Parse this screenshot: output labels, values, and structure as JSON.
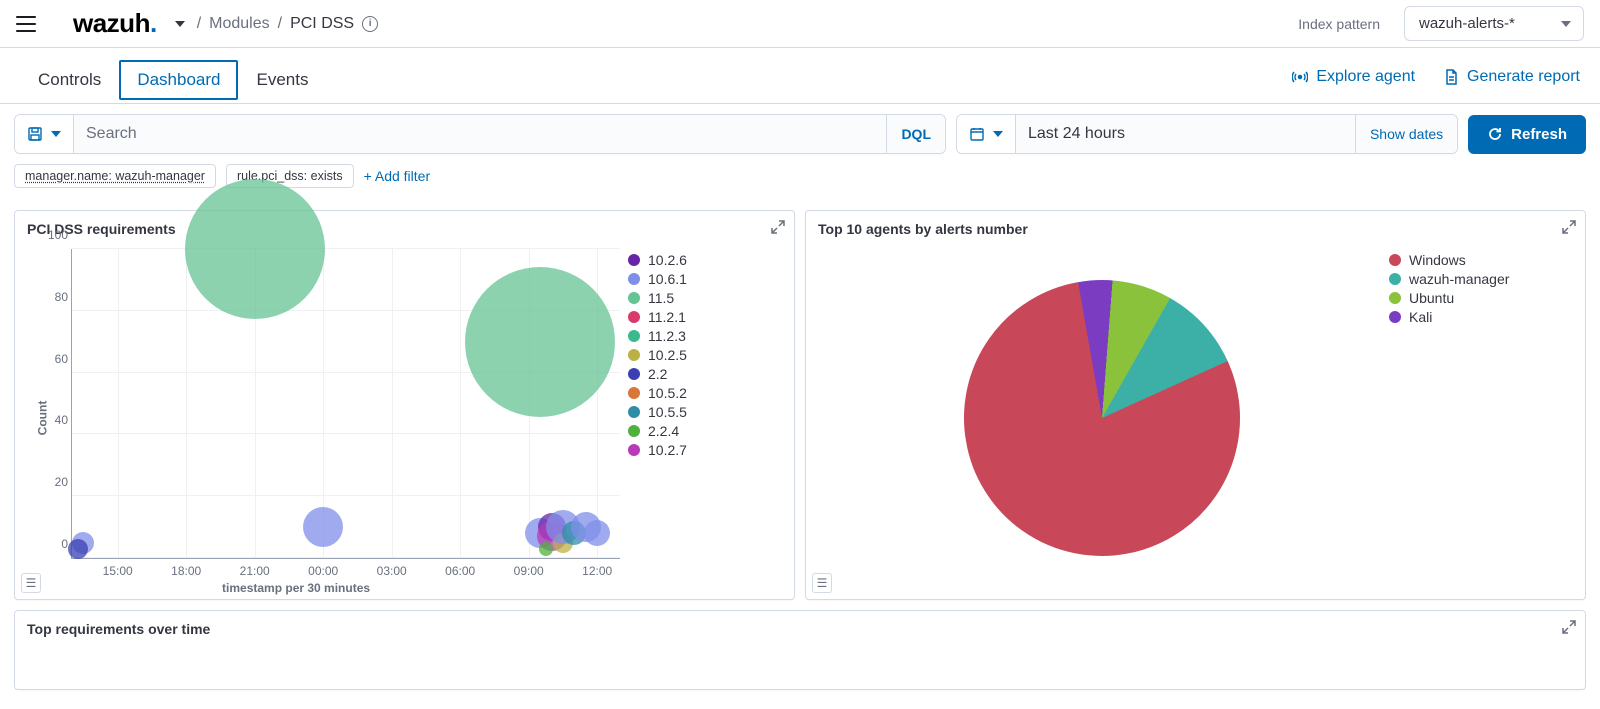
{
  "topbar": {
    "logo_prefix": "wazuh",
    "logo_dot": ".",
    "breadcrumb_modules": "Modules",
    "breadcrumb_current": "PCI DSS",
    "index_pattern_label": "Index pattern",
    "index_pattern_value": "wazuh-alerts-*"
  },
  "tabs": {
    "controls": "Controls",
    "dashboard": "Dashboard",
    "events": "Events",
    "explore_agent": "Explore agent",
    "generate_report": "Generate report"
  },
  "search": {
    "placeholder": "Search",
    "suffix": "DQL"
  },
  "date": {
    "value": "Last 24 hours",
    "show_dates": "Show dates",
    "refresh": "Refresh"
  },
  "filters": {
    "chip1": "manager.name: wazuh-manager",
    "chip2": "rule.pci_dss: exists",
    "add_filter": "+ Add filter"
  },
  "panel1_title": "PCI DSS requirements",
  "panel2_title": "Top 10 agents by alerts number",
  "panel3_title": "Top requirements over time",
  "chart_data": [
    {
      "id": "pci_requirements_bubble",
      "type": "scatter",
      "title": "PCI DSS requirements",
      "xlabel": "timestamp per 30 minutes",
      "ylabel": "Count",
      "ylim": [
        0,
        100
      ],
      "x_ticks": [
        "15:00",
        "18:00",
        "21:00",
        "00:00",
        "03:00",
        "06:00",
        "09:00",
        "12:00"
      ],
      "y_ticks": [
        0,
        20,
        40,
        60,
        80,
        100
      ],
      "series": [
        {
          "name": "10.2.6",
          "color": "#6824a9"
        },
        {
          "name": "10.6.1",
          "color": "#7f8fe8"
        },
        {
          "name": "11.5",
          "color": "#65c394"
        },
        {
          "name": "11.2.1",
          "color": "#d93a6a"
        },
        {
          "name": "11.2.3",
          "color": "#3bb98d"
        },
        {
          "name": "10.2.5",
          "color": "#b9b145"
        },
        {
          "name": "2.2",
          "color": "#3a3fb3"
        },
        {
          "name": "10.5.2",
          "color": "#d9763a"
        },
        {
          "name": "10.5.5",
          "color": "#2f8da8"
        },
        {
          "name": "2.2.4",
          "color": "#4fb03d"
        },
        {
          "name": "10.2.7",
          "color": "#b83ab8"
        }
      ],
      "bubbles": [
        {
          "x": "21:00",
          "y": 100,
          "size": 140,
          "series": "11.5"
        },
        {
          "x": "09:30",
          "y": 70,
          "size": 150,
          "series": "11.5"
        },
        {
          "x": "00:00",
          "y": 10,
          "size": 40,
          "series": "10.6.1"
        },
        {
          "x": "13:30",
          "y": 5,
          "size": 22,
          "series": "10.6.1"
        },
        {
          "x": "13:15",
          "y": 3,
          "size": 20,
          "series": "2.2"
        },
        {
          "x": "09:30",
          "y": 8,
          "size": 30,
          "series": "10.6.1"
        },
        {
          "x": "10:00",
          "y": 10,
          "size": 28,
          "series": "10.2.6"
        },
        {
          "x": "10:00",
          "y": 7,
          "size": 30,
          "series": "10.2.7"
        },
        {
          "x": "10:30",
          "y": 5,
          "size": 20,
          "series": "10.2.5"
        },
        {
          "x": "10:30",
          "y": 10,
          "size": 34,
          "series": "10.6.1"
        },
        {
          "x": "11:00",
          "y": 8,
          "size": 24,
          "series": "10.5.5"
        },
        {
          "x": "11:30",
          "y": 10,
          "size": 30,
          "series": "10.6.1"
        },
        {
          "x": "12:00",
          "y": 8,
          "size": 26,
          "series": "10.6.1"
        },
        {
          "x": "09:45",
          "y": 3,
          "size": 14,
          "series": "2.2.4"
        }
      ]
    },
    {
      "id": "top_agents_pie",
      "type": "pie",
      "title": "Top 10 agents by alerts number",
      "series": [
        {
          "name": "Windows",
          "color": "#c8485a",
          "value": 79
        },
        {
          "name": "wazuh-manager",
          "color": "#3cb0a6",
          "value": 10
        },
        {
          "name": "Ubuntu",
          "color": "#8ac23c",
          "value": 7
        },
        {
          "name": "Kali",
          "color": "#7b3cc2",
          "value": 4
        }
      ]
    }
  ]
}
